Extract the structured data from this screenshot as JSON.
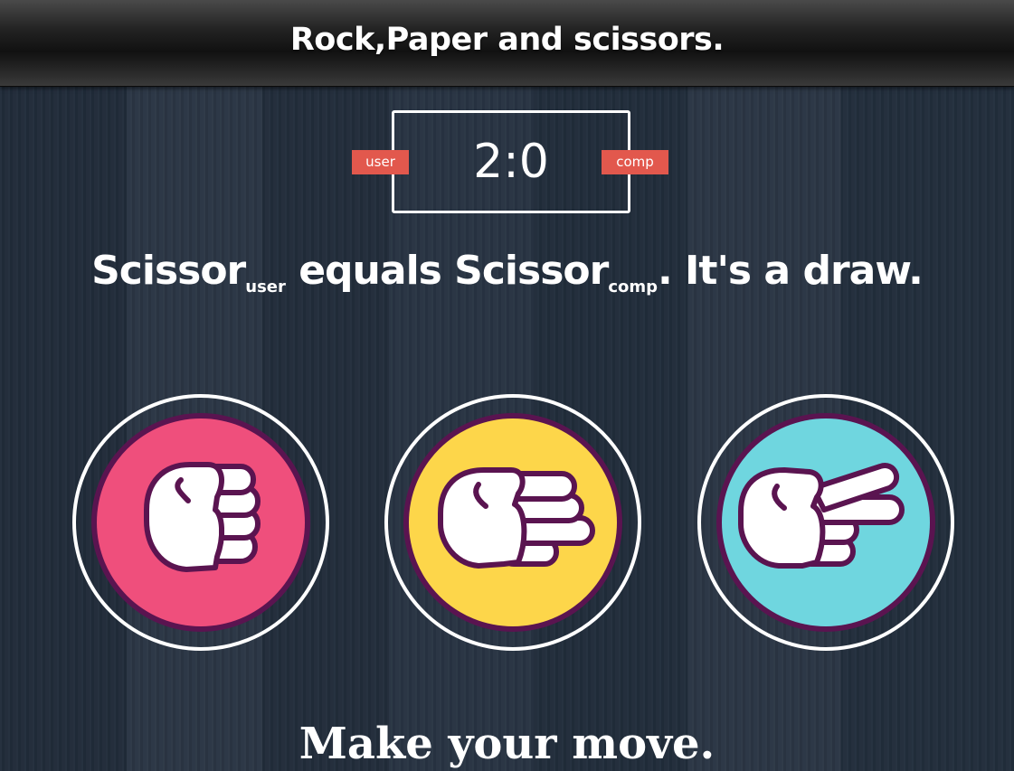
{
  "header": {
    "title": "Rock,Paper and scissors."
  },
  "scoreboard": {
    "score": "2:0",
    "user_label": "user",
    "comp_label": "comp"
  },
  "result": {
    "user_choice": "Scissor",
    "user_tag": "user",
    "verb": " equals ",
    "comp_choice": "Scissor",
    "comp_tag": "comp",
    "outcome": ". It's a draw."
  },
  "choices": [
    {
      "name": "rock",
      "icon": "fist-icon",
      "color": "#ef4f7c"
    },
    {
      "name": "paper",
      "icon": "open-hand-icon",
      "color": "#fdd64a"
    },
    {
      "name": "scissors",
      "icon": "scissors-hand-icon",
      "color": "#6fd6df"
    }
  ],
  "prompt": "Make your move.",
  "colors": {
    "outline": "#5a1450",
    "badge": "#e2584d",
    "background": "#24303f"
  }
}
